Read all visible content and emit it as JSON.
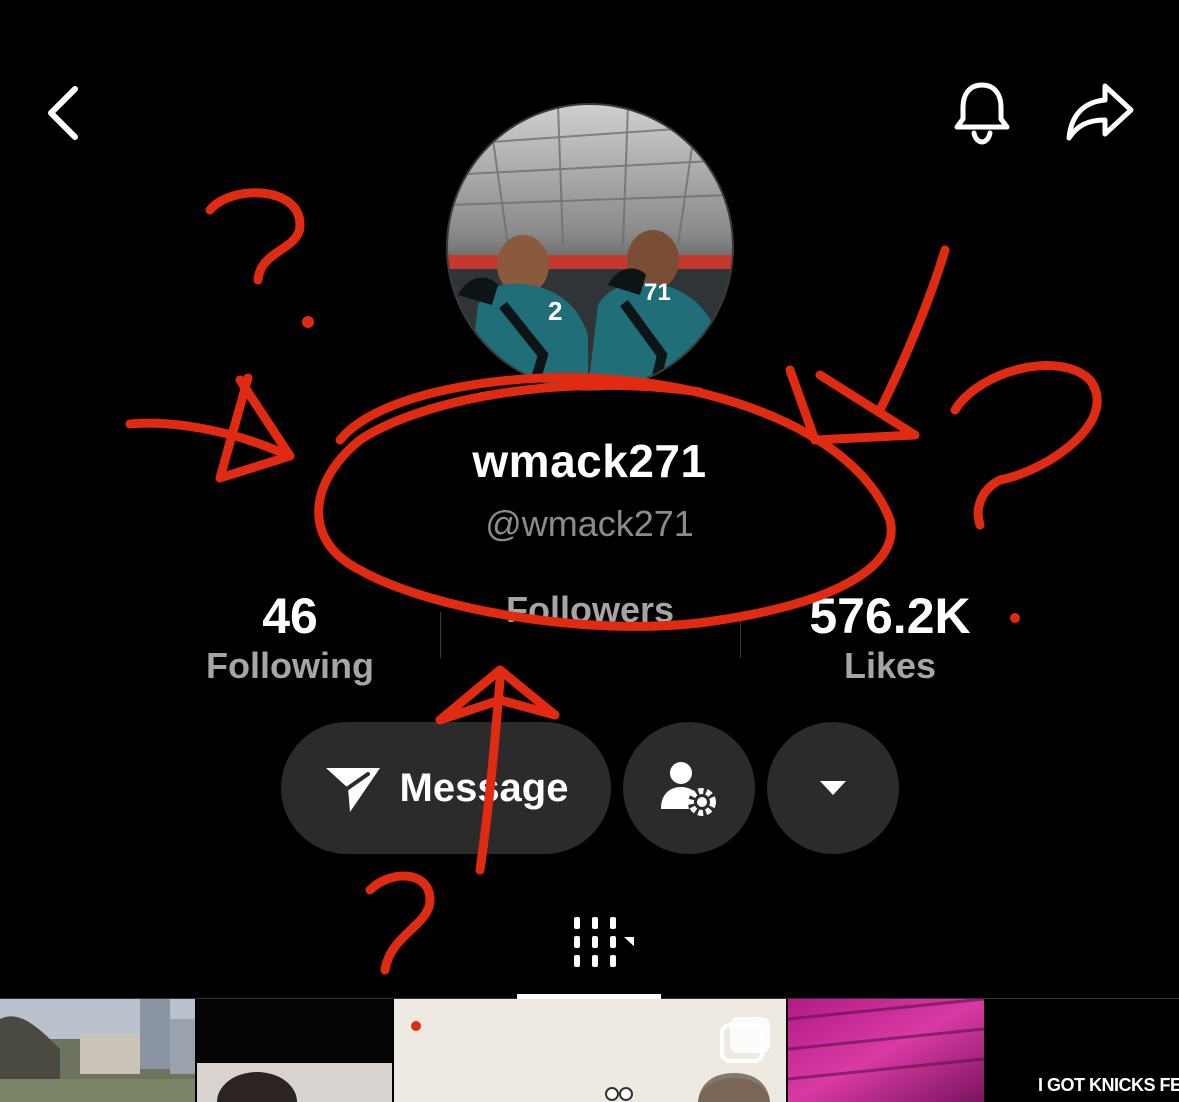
{
  "profile": {
    "display_name": "wmack271",
    "handle": "@wmack271"
  },
  "stats": [
    {
      "value": "46",
      "label": "Following"
    },
    {
      "value": "",
      "label": "Followers"
    },
    {
      "value": "576.2K",
      "label": "Likes"
    }
  ],
  "actions": {
    "message_label": "Message"
  },
  "thumbnails": {
    "caption_5": "I GOT KNICKS FE"
  },
  "icons": {
    "back": "chevron-left-icon",
    "notifications": "bell-icon",
    "share": "share-arrow-icon",
    "message": "paper-plane-icon",
    "friend_settings": "user-gear-icon",
    "more": "caret-down-icon",
    "videos_tab": "grid-bars-icon"
  },
  "colors": {
    "background": "#000000",
    "pill": "#2b2b2b",
    "muted_text": "#8b8b8b",
    "annotation_red": "#e02a12"
  }
}
